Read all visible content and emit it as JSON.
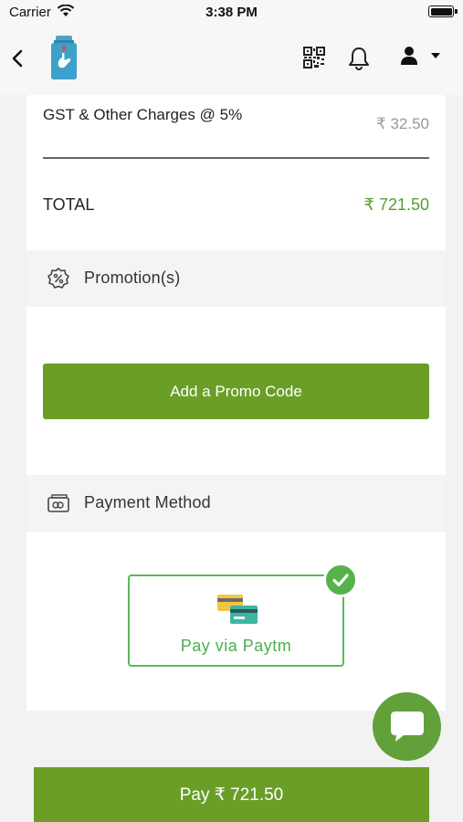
{
  "status_bar": {
    "carrier": "Carrier",
    "time": "3:38 PM"
  },
  "charges": {
    "gst_label": "GST & Other Charges @ 5%",
    "gst_value": "₹ 32.50",
    "total_label": "TOTAL",
    "total_value": "₹ 721.50"
  },
  "promotion": {
    "title": "Promotion(s)",
    "button_label": "Add a Promo Code"
  },
  "payment": {
    "title": "Payment Method",
    "option_label": "Pay via Paytm",
    "option_selected": true
  },
  "footer": {
    "pay_label": "Pay ₹ 721.50"
  },
  "colors": {
    "accent_green": "#6a9e27",
    "total_green": "#5a9e2e",
    "option_green": "#4caf50"
  },
  "icons": [
    "back-icon",
    "app-logo",
    "qr-code-icon",
    "bell-icon",
    "user-icon",
    "caret-down-icon",
    "promotion-icon",
    "payment-method-icon",
    "cards-icon",
    "check-icon",
    "chat-icon"
  ]
}
